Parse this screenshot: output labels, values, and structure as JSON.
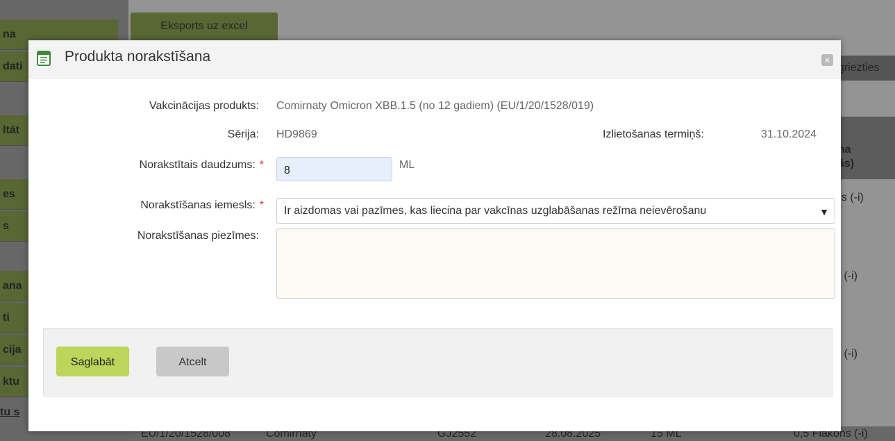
{
  "background": {
    "export_button": "Eksports uz excel",
    "sidebar_fragments": [
      "na",
      "dati",
      "ltāt",
      "es",
      "s",
      "ana",
      "ti",
      "cija",
      "ktu",
      "tu s"
    ],
    "right_header": "griezties",
    "right_th": "na\nās)",
    "right_cells": [
      "ns (-i)",
      "s (-i)",
      "s (-i)",
      "0,5 Flakons (-i)"
    ],
    "bottom_row": [
      "EU/1/20/1528/008",
      "Comirnaty",
      "GJ2552",
      "28.08.2025",
      "15 ML"
    ]
  },
  "dialog": {
    "title": "Produkta norakstīšana",
    "close_label": "×",
    "fields": {
      "product_label": "Vakcinācijas produkts:",
      "product_value": "Comirnaty Omicron XBB.1.5 (no 12 gadiem) (EU/1/20/1528/019)",
      "series_label": "Sērija:",
      "series_value": "HD9869",
      "expiry_label": "Izlietošanas termiņš:",
      "expiry_value": "31.10.2024",
      "quantity_label": "Norakstītais daudzums:",
      "quantity_value": "8",
      "quantity_unit": "ML",
      "reason_label": "Norakstīšanas iemesls:",
      "reason_value": "Ir aizdomas vai pazīmes, kas liecina par vakcīnas uzglabāšanas režīma neievērošanu",
      "notes_label": "Norakstīšanas piezīmes:",
      "notes_value": "",
      "required_mark": "*"
    },
    "buttons": {
      "save": "Saglabāt",
      "cancel": "Atcelt"
    }
  },
  "colors": {
    "save_button": "#bcd55a",
    "cancel_button": "#c8c8c8",
    "sidebar_item": "#6f8a2c",
    "required": "#dd3333"
  }
}
